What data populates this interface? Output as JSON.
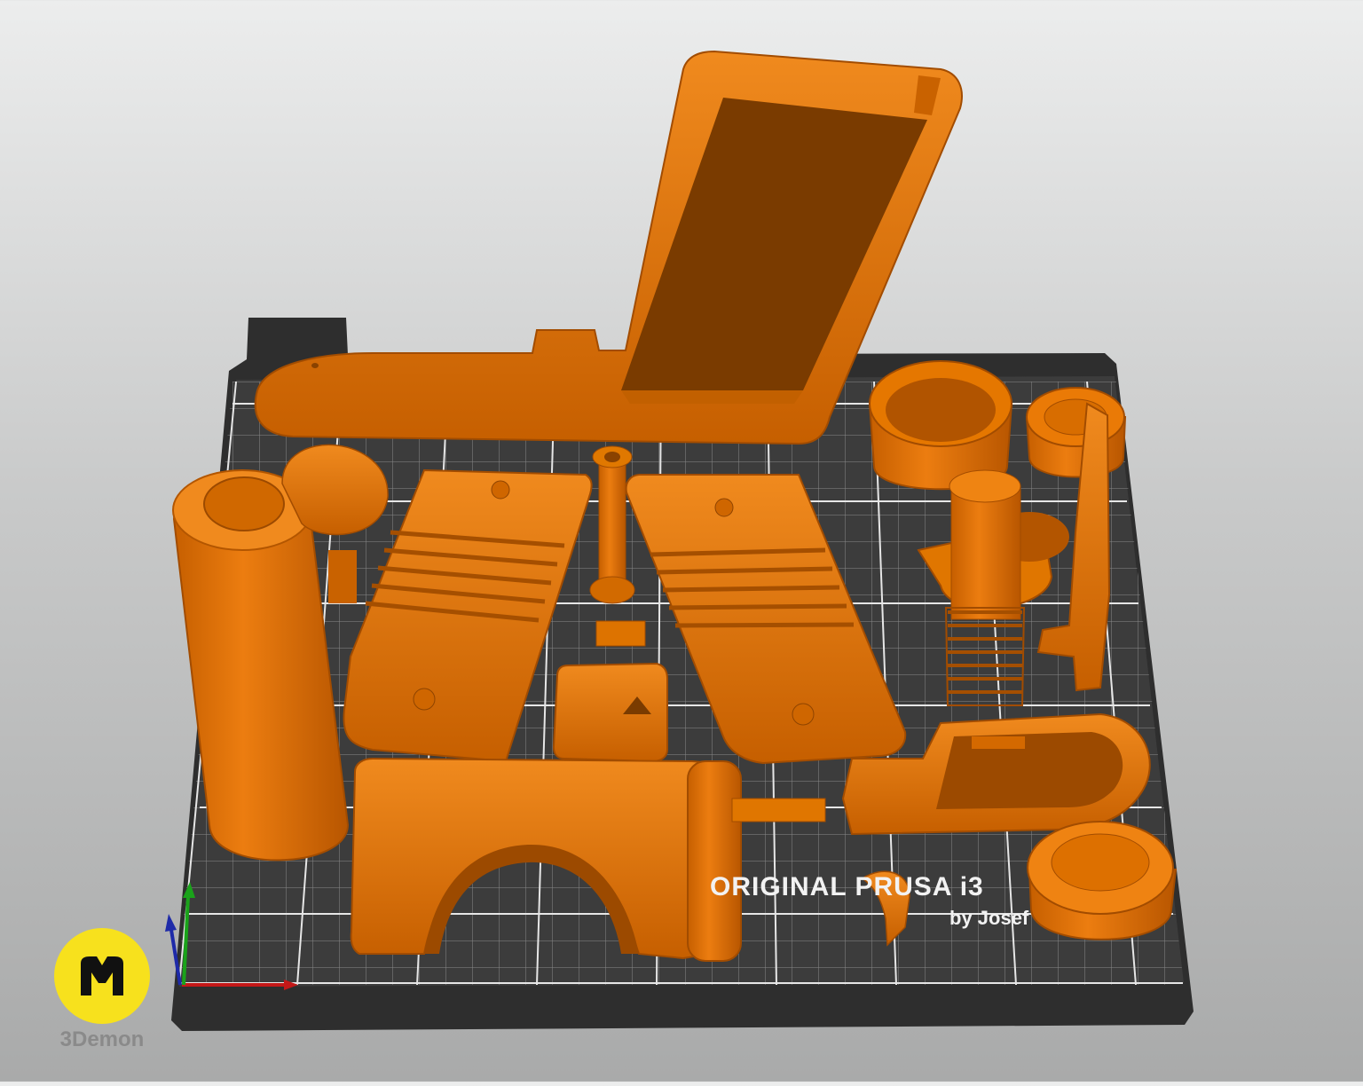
{
  "bed": {
    "label": "ORIGINAL PRUSA i3",
    "sublabel": "by Josef"
  },
  "brand": {
    "text": "3Demon",
    "badge_color": "#f7e11d"
  },
  "colors": {
    "part": "#e07000",
    "part_dark": "#a54f00",
    "part_light": "#f08a1e",
    "bed_surface": "#3b3b3b",
    "grid": "#e8e8e8"
  },
  "axes": [
    "x-axis",
    "y-axis",
    "z-axis"
  ]
}
